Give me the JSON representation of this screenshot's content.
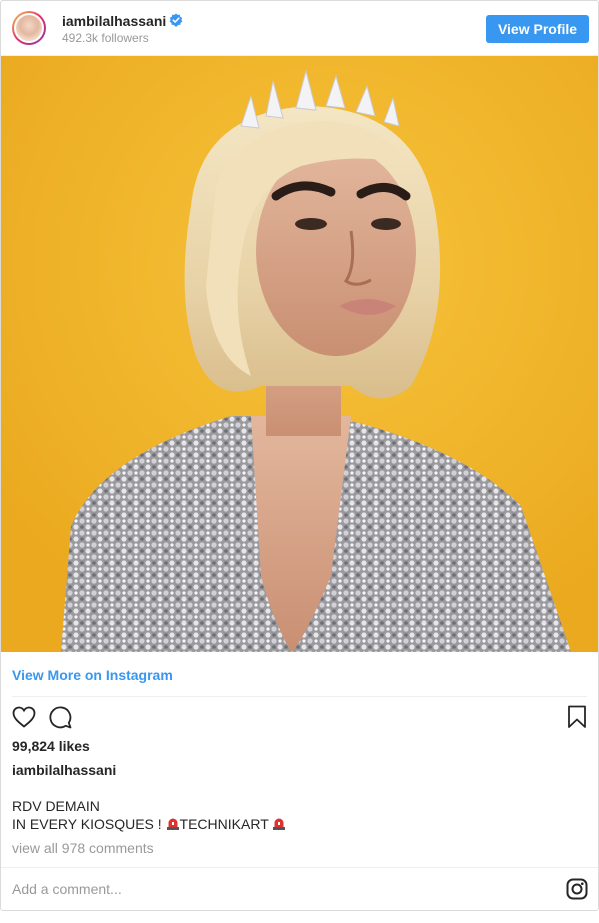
{
  "header": {
    "username": "iambilalhassani",
    "followers": "492.3k followers",
    "view_profile_label": "View Profile"
  },
  "post": {
    "view_more_label": "View More on Instagram",
    "likes": "99,824 likes",
    "caption_username": "iambilalhassani",
    "caption_line1": "RDV DEMAIN",
    "caption_line2_prefix": "IN EVERY KIOSQUES ! ",
    "caption_line2_text": "TECHNIKART",
    "caption_line2_emoji": "siren-icon",
    "view_comments": "view all 978 comments",
    "add_comment_placeholder": "Add a comment..."
  },
  "icons": {
    "like": "heart-icon",
    "comment": "comment-icon",
    "save": "bookmark-icon",
    "verified": "verified-badge-icon",
    "brand": "instagram-logo-icon"
  },
  "colors": {
    "accent": "#3897f0",
    "photo_background": "#f2b62c"
  }
}
